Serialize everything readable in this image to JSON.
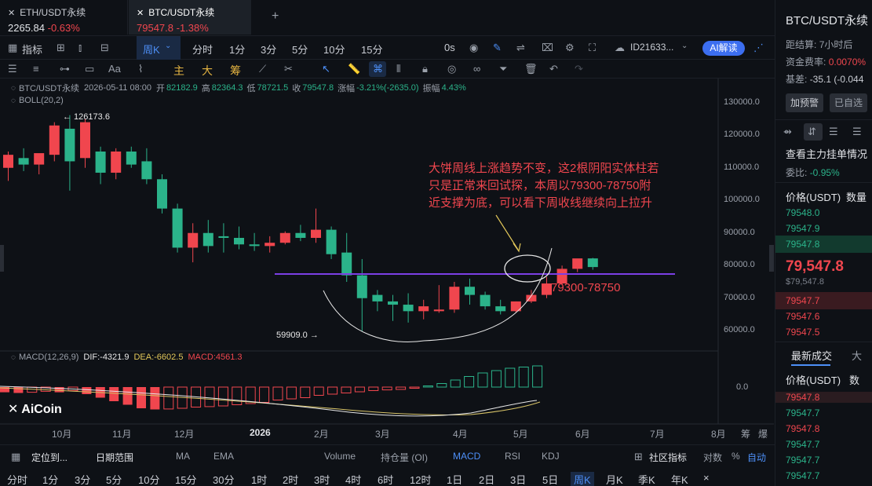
{
  "tabs": [
    {
      "name": "ETH/USDT永续",
      "price": "2265.84",
      "change": "-0.63%"
    },
    {
      "name": "BTC/USDT永续",
      "price": "79547.8",
      "change": "-1.38%"
    }
  ],
  "add_tab": "+",
  "toolbar": {
    "indicator_label": "指标",
    "period_selected": "周K",
    "periods": [
      "分时",
      "1分",
      "3分",
      "5分",
      "10分",
      "15分"
    ],
    "seconds": "0s",
    "id_label": "ID21633...",
    "ai_label": "AI解读"
  },
  "drawbar": {
    "tool_chars": [
      "主",
      "大",
      "筹"
    ]
  },
  "ohlc": {
    "symbol": "BTC/USDT永续",
    "date": "2026-05-11 08:00",
    "open_label": "开",
    "open": "82182.9",
    "high_label": "高",
    "high": "82364.3",
    "low_label": "低",
    "low": "78721.5",
    "close_label": "收",
    "close": "79547.8",
    "chg_label": "涨幅",
    "chg": "-3.21%(-2635.0)",
    "amp_label": "振幅",
    "amp": "4.43%",
    "boll": "BOLL(20,2)"
  },
  "annotations": {
    "high_marker": "← 126173.6",
    "low_marker": "59909.0 →",
    "support_label": "79300-78750",
    "comment": [
      "大饼周线上涨趋势不变，这2根阴阳实体柱若",
      "只是正常来回试探，本周以79300-78750附",
      "近支撑为底，可以看下周收线继续向上拉升"
    ]
  },
  "price_axis": [
    "130000.0",
    "120000.0",
    "110000.0",
    "100000.0",
    "90000.0",
    "80000.0",
    "70000.0",
    "60000.0"
  ],
  "macd": {
    "label": "MACD(12,26,9)",
    "dif": "DIF:-4321.9",
    "dea": "DEA:-6602.5",
    "macd": "MACD:4561.3",
    "zero": "0.0"
  },
  "time_axis": [
    "10月",
    "11月",
    "12月",
    "2026",
    "2月",
    "3月",
    "4月",
    "5月",
    "6月",
    "7月",
    "8月"
  ],
  "time_axis_right": [
    "筹",
    "爆"
  ],
  "logo": "AiCoin",
  "indicator_bar": {
    "locate": "定位到...",
    "range": "日期范围",
    "items": [
      "MA",
      "EMA",
      "Volume",
      "持仓量 (OI)",
      "MACD",
      "RSI",
      "KDJ"
    ],
    "community": "社区指标",
    "log": "对数",
    "pct": "%",
    "auto": "自动"
  },
  "period_bar": [
    "分时",
    "1分",
    "3分",
    "5分",
    "10分",
    "15分",
    "30分",
    "1时",
    "2时",
    "3时",
    "4时",
    "6时",
    "12时",
    "1日",
    "2日",
    "3日",
    "5日",
    "周K",
    "月K",
    "季K",
    "年K",
    "×"
  ],
  "period_bar_selected": "周K",
  "sidebar": {
    "title": "BTC/USDT永续",
    "funding_label": "距结算:",
    "funding_time": "7小时后",
    "rate_label": "资金费率:",
    "rate": "0.0070%",
    "basis_label": "基差:",
    "basis": "-35.1 (-0.044",
    "btn_alert": "加预警",
    "btn_fav": "已自选",
    "orderbook_title": "查看主力挂单情况",
    "ratio_label": "委比:",
    "ratio": "-0.95%",
    "price_header": "价格(USDT)",
    "qty_header": "数量",
    "asks": [
      "79548.0",
      "79547.9",
      "79547.8"
    ],
    "last": "79,547.8",
    "last_sub": "$79,547.8",
    "bids": [
      "79547.7",
      "79547.6",
      "79547.5"
    ],
    "trades_title": "最新成交",
    "trades_title2": "大",
    "trades_price_header": "价格(USDT)",
    "trades_qty_header": "数",
    "trades": [
      {
        "p": "79547.8",
        "c": "red"
      },
      {
        "p": "79547.7",
        "c": "green"
      },
      {
        "p": "79547.8",
        "c": "red"
      },
      {
        "p": "79547.7",
        "c": "green"
      },
      {
        "p": "79547.7",
        "c": "green"
      },
      {
        "p": "79547.7",
        "c": "green"
      }
    ]
  },
  "chart_data": {
    "type": "candlestick",
    "timeframe": "weekly",
    "ylim": [
      55000,
      135000
    ],
    "candles": [
      {
        "o": 110000,
        "h": 115000,
        "l": 106000,
        "c": 114000
      },
      {
        "o": 113000,
        "h": 116000,
        "l": 109000,
        "c": 111000
      },
      {
        "o": 111000,
        "h": 114000,
        "l": 108000,
        "c": 114500
      },
      {
        "o": 114000,
        "h": 124000,
        "l": 112000,
        "c": 123000
      },
      {
        "o": 122000,
        "h": 126173.6,
        "l": 103000,
        "c": 112000
      },
      {
        "o": 113000,
        "h": 125000,
        "l": 110000,
        "c": 124000
      },
      {
        "o": 115000,
        "h": 116500,
        "l": 105000,
        "c": 108500
      },
      {
        "o": 108500,
        "h": 116000,
        "l": 106500,
        "c": 115000
      },
      {
        "o": 115000,
        "h": 116500,
        "l": 110000,
        "c": 111000
      },
      {
        "o": 112000,
        "h": 116000,
        "l": 105000,
        "c": 106500
      },
      {
        "o": 106500,
        "h": 108000,
        "l": 96000,
        "c": 97500
      },
      {
        "o": 97500,
        "h": 99000,
        "l": 84000,
        "c": 85500
      },
      {
        "o": 85500,
        "h": 93000,
        "l": 81000,
        "c": 90000
      },
      {
        "o": 90000,
        "h": 94000,
        "l": 84000,
        "c": 86000
      },
      {
        "o": 89000,
        "h": 93000,
        "l": 84000,
        "c": 88500
      },
      {
        "o": 88500,
        "h": 92000,
        "l": 85000,
        "c": 86500
      },
      {
        "o": 86500,
        "h": 90000,
        "l": 84500,
        "c": 86000
      },
      {
        "o": 86000,
        "h": 89000,
        "l": 84000,
        "c": 87000
      },
      {
        "o": 87000,
        "h": 90500,
        "l": 86500,
        "c": 90000
      },
      {
        "o": 90000,
        "h": 92500,
        "l": 87500,
        "c": 88500
      },
      {
        "o": 88500,
        "h": 97500,
        "l": 87000,
        "c": 91000
      },
      {
        "o": 91000,
        "h": 92000,
        "l": 82000,
        "c": 83500
      },
      {
        "o": 84000,
        "h": 90000,
        "l": 75000,
        "c": 77000
      },
      {
        "o": 77000,
        "h": 82000,
        "l": 59909,
        "c": 70000
      },
      {
        "o": 71000,
        "h": 72500,
        "l": 66000,
        "c": 69000
      },
      {
        "o": 69000,
        "h": 71000,
        "l": 63000,
        "c": 68000
      },
      {
        "o": 68000,
        "h": 71500,
        "l": 62500,
        "c": 66000
      },
      {
        "o": 66000,
        "h": 69500,
        "l": 63500,
        "c": 67500
      },
      {
        "o": 66000,
        "h": 74000,
        "l": 65500,
        "c": 66500
      },
      {
        "o": 66500,
        "h": 75000,
        "l": 65500,
        "c": 73500
      },
      {
        "o": 73500,
        "h": 76000,
        "l": 68000,
        "c": 71000
      },
      {
        "o": 71000,
        "h": 72000,
        "l": 66500,
        "c": 67500
      },
      {
        "o": 67500,
        "h": 69500,
        "l": 65000,
        "c": 66000
      },
      {
        "o": 66000,
        "h": 69000,
        "l": 65500,
        "c": 69000
      },
      {
        "o": 69000,
        "h": 72500,
        "l": 68500,
        "c": 71000
      },
      {
        "o": 71000,
        "h": 76500,
        "l": 70000,
        "c": 74500
      },
      {
        "o": 74500,
        "h": 80000,
        "l": 74000,
        "c": 79000
      },
      {
        "o": 79000,
        "h": 82000,
        "l": 78000,
        "c": 82200
      },
      {
        "o": 82200,
        "h": 82364.3,
        "l": 78721.5,
        "c": 79547.8
      }
    ],
    "support_zone": [
      79300,
      78750
    ],
    "macd_hist": [
      -0.22,
      -0.25,
      -0.22,
      -0.18,
      -0.22,
      -0.15,
      -0.3,
      -0.45,
      -0.6,
      -0.75,
      -0.9,
      -0.95,
      -0.93,
      -0.9,
      -0.85,
      -0.83,
      -0.8,
      -0.75,
      -0.7,
      -0.65,
      -0.55,
      -0.5,
      -0.45,
      -0.35,
      -0.3,
      -0.25,
      -0.2,
      -0.15,
      -0.12,
      -0.1,
      -0.05,
      0.05,
      0.15,
      0.3,
      0.45,
      0.6,
      0.7,
      0.8,
      0.85,
      0.9
    ]
  }
}
